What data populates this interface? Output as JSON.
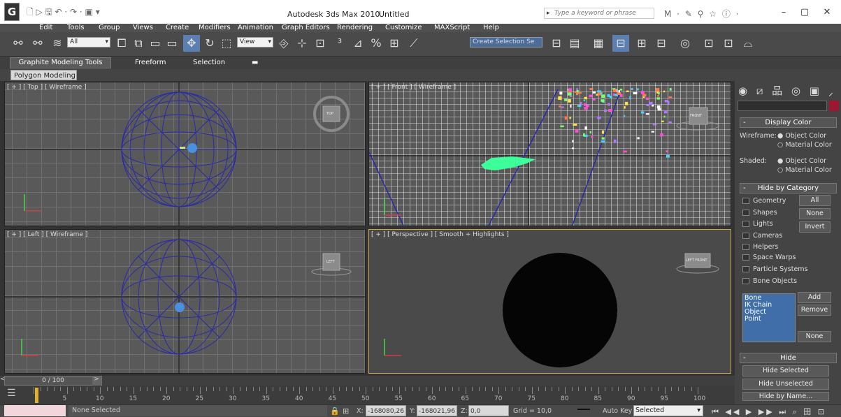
{
  "titlebar": {
    "app_icon": "3ds-max-logo-icon",
    "app_icon_glyph": "G",
    "title": "Autodesk 3ds Max 2010",
    "doc": "Untitled",
    "search_placeholder": "Type a keyword or phrase",
    "quick_access_glyphs": "🗋 ▷ 🖫 ↶ · ↷ · ▣ ▾",
    "info_glyphs": "M · ✎ ⚲ ☆ ⓘ ·",
    "minimize": "–",
    "maximize": "▢",
    "close": "✕"
  },
  "menu": [
    "Edit",
    "Tools",
    "Group",
    "Views",
    "Create",
    "Modifiers",
    "Animation",
    "Graph Editors",
    "Rendering",
    "Customize",
    "MAXScript",
    "Help"
  ],
  "toolbar": {
    "filter_value": "All",
    "refcoord_value": "View",
    "selection_set_value": "Create Selection Se",
    "glyphs": [
      "⚯",
      "⚯",
      "≋",
      "⧠",
      "⧉",
      "▭",
      "▭",
      "✥",
      "↻",
      "⬚",
      "⎆",
      "⊹",
      "⊡",
      "³",
      "⊿",
      "%",
      "⊞",
      "⟋",
      "⊟",
      "▤",
      "▦",
      "⊟",
      "⊞",
      "⊟",
      "⊡",
      "◎",
      "⊡",
      "⊡",
      "⌓"
    ]
  },
  "ribbon": {
    "tabs": [
      "Graphite Modeling Tools",
      "Freeform",
      "Selection"
    ],
    "extra": "▬",
    "subtab": "Polygon Modeling"
  },
  "viewports": {
    "top": "[ + ] [ Top ] [ Wireframe ]",
    "front": "[ + ] [ Front ] [ Wireframe ]",
    "left": "[ + ] [ Left ] [ Wireframe ]",
    "persp": "[ + ] [ Perspective ] [ Smooth + Highlights ]",
    "viewcube_top": "TOP",
    "viewcube_front": "FRONT",
    "viewcube_left": "LEFT",
    "viewcube_persp": "LEFT  FRONT"
  },
  "cmdpanel": {
    "tab_glyphs": "◉ ⧄ 品 ◎ ▣ ⸝",
    "display_color": "Display Color",
    "wireframe_label": "Wireframe:",
    "shaded_label": "Shaded:",
    "object_color": "Object Color",
    "material_color": "Material Color",
    "hide_by_category": "Hide by Category",
    "categories": [
      "Geometry",
      "Shapes",
      "Lights",
      "Cameras",
      "Helpers",
      "Space Warps",
      "Particle Systems",
      "Bone Objects"
    ],
    "btn_all": "All",
    "btn_none": "None",
    "btn_invert": "Invert",
    "bones_list": [
      "Bone",
      "IK Chain Object",
      "Point"
    ],
    "btn_add": "Add",
    "btn_remove": "Remove",
    "btn_none2": "None",
    "hide": "Hide",
    "hide_selected": "Hide Selected",
    "hide_unselected": "Hide Unselected",
    "hide_by_name": "Hide by Name..."
  },
  "timeline": {
    "slider": "0 / 100",
    "ticks": [
      "5",
      "10",
      "15",
      "20",
      "25",
      "30",
      "35",
      "40",
      "45",
      "50",
      "55",
      "60",
      "65",
      "70",
      "75",
      "80",
      "85",
      "90",
      "95",
      "100"
    ],
    "prev": "<",
    "next": ">"
  },
  "status": {
    "selection": "None Selected",
    "x_label": "X:",
    "x_value": "-168080,26",
    "y_label": "Y:",
    "y_value": "-168021,96",
    "z_label": "Z:",
    "z_value": "0,0",
    "grid": "Grid = 10,0",
    "auto_key": "Auto Key",
    "key_filter": "Selected",
    "playback_glyphs": "⏮ ◀◀ ▶ ▶▶ ⏭ ⌕ 田 ⊡"
  },
  "colors": {
    "accent": "#c9a74a",
    "wire_sphere": "#2a2aa8",
    "green_object": "#3dff9a",
    "material_swatch": "#9b1830"
  }
}
